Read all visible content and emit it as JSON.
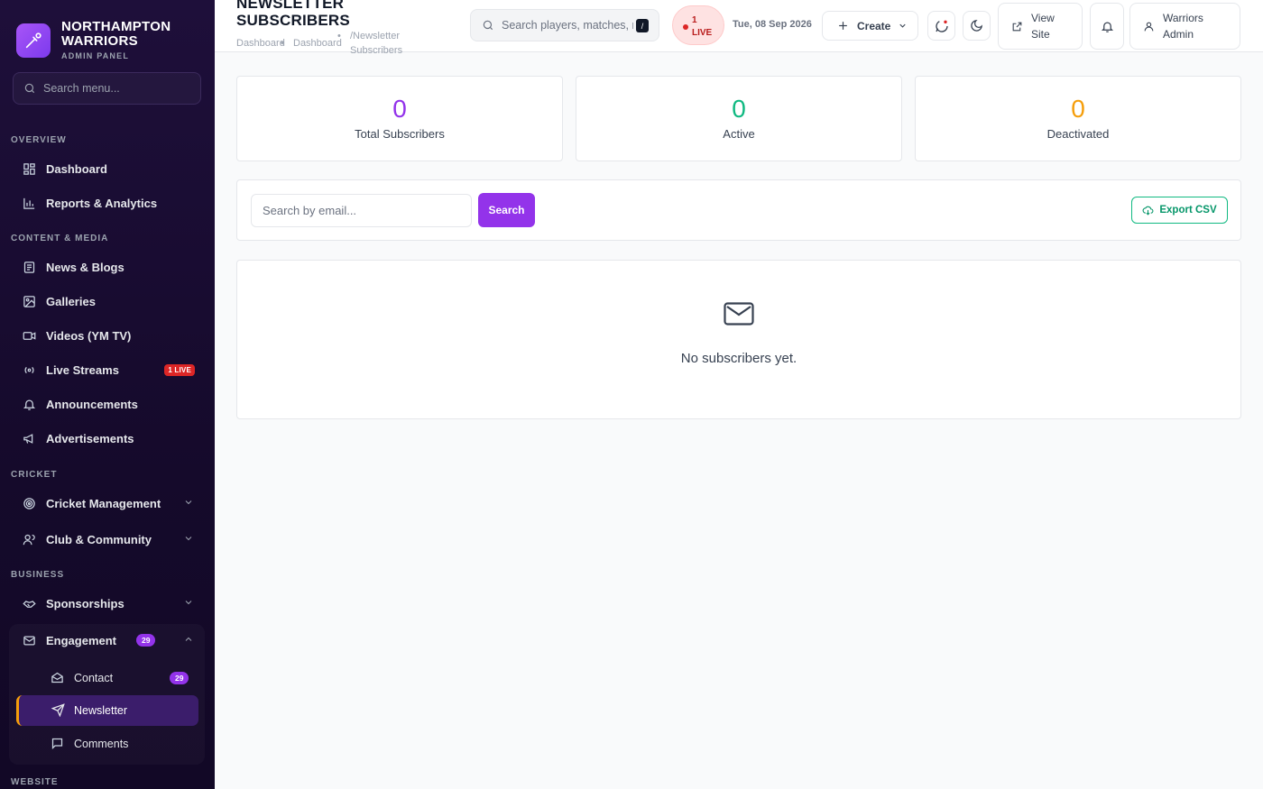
{
  "brand": {
    "name_line1": "NORTHAMPTON",
    "name_line2": "WARRIORS",
    "subtitle": "ADMIN PANEL"
  },
  "sidebar": {
    "search_placeholder": "Search menu...",
    "sections": {
      "overview": "OVERVIEW",
      "content": "CONTENT & MEDIA",
      "cricket": "CRICKET",
      "business": "BUSINESS",
      "website": "WEBSITE"
    },
    "items": {
      "dashboard": "Dashboard",
      "reports": "Reports & Analytics",
      "news": "News & Blogs",
      "galleries": "Galleries",
      "videos": "Videos (YM TV)",
      "live_streams": "Live Streams",
      "live_badge": "1 LIVE",
      "announcements": "Announcements",
      "advertisements": "Advertisements",
      "cricket_mgmt": "Cricket Management",
      "club": "Club & Community",
      "sponsorships": "Sponsorships",
      "engagement": "Engagement",
      "engagement_count": "29"
    },
    "sub_items": {
      "contact": "Contact",
      "contact_count": "29",
      "newsletter": "Newsletter",
      "comments": "Comments"
    }
  },
  "header": {
    "title_line1": "NEWSLETTER",
    "title_line2": "SUBSCRIBERS",
    "breadcrumb": [
      "Dashboard",
      "Dashboard",
      "/Newsletter Subscribers"
    ],
    "search_placeholder": "Search players, matches, news...",
    "search_shortcut": "/",
    "live_count": "1",
    "live_label": "LIVE",
    "date": "Tue, 08 Sep 2026",
    "create_label": "Create",
    "view_site_line1": "View",
    "view_site_line2": "Site",
    "user_line1": "Warriors",
    "user_line2": "Admin"
  },
  "stats": [
    {
      "value": "0",
      "label": "Total Subscribers",
      "color": "#9333ea"
    },
    {
      "value": "0",
      "label": "Active",
      "color": "#10b981"
    },
    {
      "value": "0",
      "label": "Deactivated",
      "color": "#f59e0b"
    }
  ],
  "toolbar": {
    "email_placeholder": "Search by email...",
    "search_label": "Search",
    "export_label": "Export CSV"
  },
  "empty_state": {
    "message": "No subscribers yet."
  },
  "colors": {
    "accent": "#9333ea",
    "success": "#10b981",
    "warning": "#f59e0b",
    "danger": "#dc2626"
  }
}
